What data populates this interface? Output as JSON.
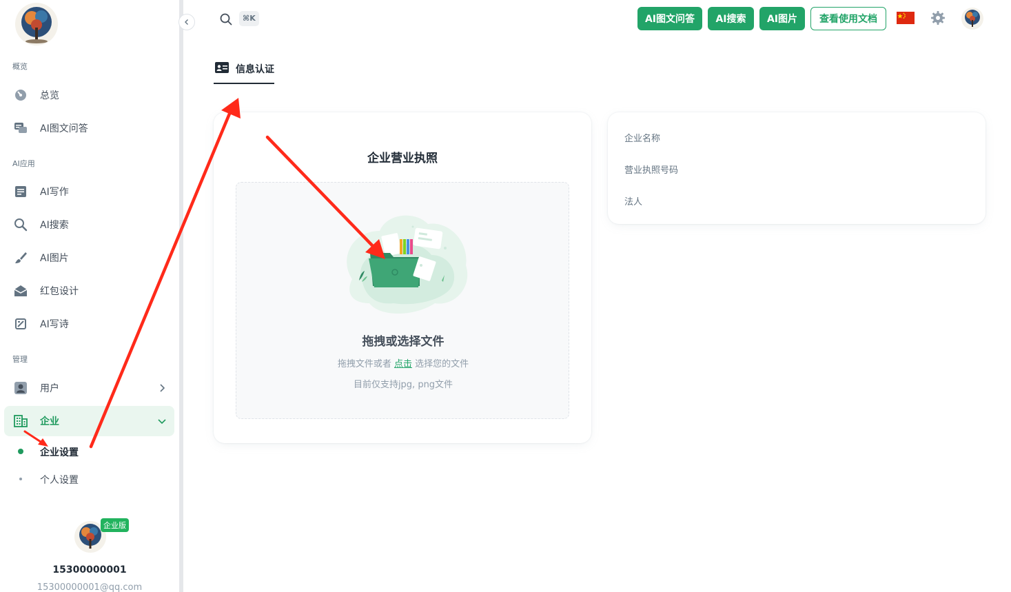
{
  "sidebar": {
    "sections": {
      "overview": "概览",
      "ai_apps": "AI应用",
      "manage": "管理"
    },
    "items": {
      "overview": "总览",
      "ai_qa": "AI图文问答",
      "ai_write": "AI写作",
      "ai_search": "AI搜索",
      "ai_image": "AI图片",
      "red_packet": "红包设计",
      "ai_poem": "AI写诗",
      "users": "用户",
      "enterprise": "企业",
      "enterprise_settings": "企业设置",
      "personal_settings": "个人设置"
    },
    "user": {
      "badge": "企业版",
      "phone": "15300000001",
      "email": "15300000001@qq.com"
    }
  },
  "topbar": {
    "shortcut": "⌘K",
    "buttons": [
      "AI图文问答",
      "AI搜索",
      "AI图片",
      "查看使用文档"
    ]
  },
  "tabs": {
    "info_auth": "信息认证"
  },
  "license_card": {
    "title": "企业营业执照",
    "drop_title": "拖拽或选择文件",
    "drop_hint_pre": "拖拽文件或者",
    "drop_hint_link": "点击",
    "drop_hint_post": "选择您的文件",
    "drop_support": "目前仅支持jpg, png文件"
  },
  "info_card": {
    "fields": [
      "企业名称",
      "营业执照号码",
      "法人"
    ]
  },
  "colors": {
    "accent": "#22a468",
    "annotation": "#ff2a1a"
  }
}
